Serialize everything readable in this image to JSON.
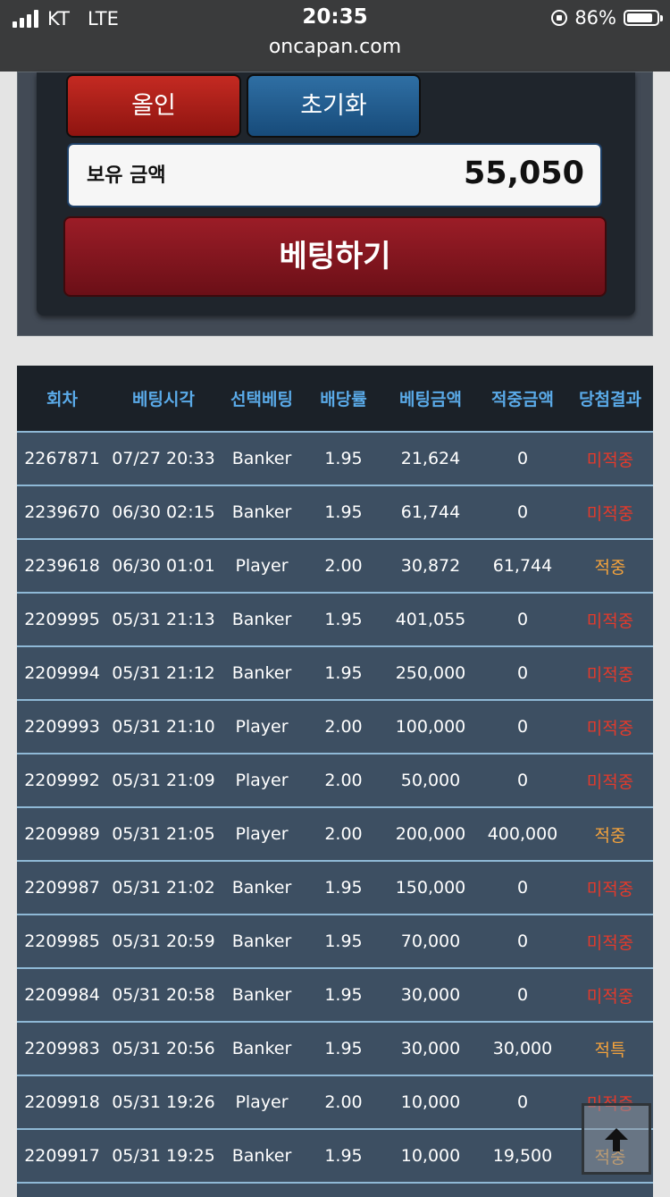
{
  "status_bar": {
    "carrier": "KT",
    "network": "LTE",
    "time": "20:35",
    "battery": "86%",
    "battery_level": 0.86,
    "url": "oncapan.com"
  },
  "controls": {
    "allin_label": "올인",
    "reset_label": "초기화",
    "balance_label": "보유 금액",
    "balance_value": "55,050",
    "bet_label": "베팅하기"
  },
  "table": {
    "headers": [
      "회차",
      "베팅시각",
      "선택베팅",
      "배당률",
      "베팅금액",
      "적중금액",
      "당첨결과"
    ],
    "rows": [
      {
        "round": "2267871",
        "time": "07/27 20:33",
        "choice": "Banker",
        "odds": "1.95",
        "bet": "21,624",
        "win": "0",
        "result": "미적중",
        "status": "miss"
      },
      {
        "round": "2239670",
        "time": "06/30 02:15",
        "choice": "Banker",
        "odds": "1.95",
        "bet": "61,744",
        "win": "0",
        "result": "미적중",
        "status": "miss"
      },
      {
        "round": "2239618",
        "time": "06/30 01:01",
        "choice": "Player",
        "odds": "2.00",
        "bet": "30,872",
        "win": "61,744",
        "result": "적중",
        "status": "hit"
      },
      {
        "round": "2209995",
        "time": "05/31 21:13",
        "choice": "Banker",
        "odds": "1.95",
        "bet": "401,055",
        "win": "0",
        "result": "미적중",
        "status": "miss"
      },
      {
        "round": "2209994",
        "time": "05/31 21:12",
        "choice": "Banker",
        "odds": "1.95",
        "bet": "250,000",
        "win": "0",
        "result": "미적중",
        "status": "miss"
      },
      {
        "round": "2209993",
        "time": "05/31 21:10",
        "choice": "Player",
        "odds": "2.00",
        "bet": "100,000",
        "win": "0",
        "result": "미적중",
        "status": "miss"
      },
      {
        "round": "2209992",
        "time": "05/31 21:09",
        "choice": "Player",
        "odds": "2.00",
        "bet": "50,000",
        "win": "0",
        "result": "미적중",
        "status": "miss"
      },
      {
        "round": "2209989",
        "time": "05/31 21:05",
        "choice": "Player",
        "odds": "2.00",
        "bet": "200,000",
        "win": "400,000",
        "result": "적중",
        "status": "hit"
      },
      {
        "round": "2209987",
        "time": "05/31 21:02",
        "choice": "Banker",
        "odds": "1.95",
        "bet": "150,000",
        "win": "0",
        "result": "미적중",
        "status": "miss"
      },
      {
        "round": "2209985",
        "time": "05/31 20:59",
        "choice": "Banker",
        "odds": "1.95",
        "bet": "70,000",
        "win": "0",
        "result": "미적중",
        "status": "miss"
      },
      {
        "round": "2209984",
        "time": "05/31 20:58",
        "choice": "Banker",
        "odds": "1.95",
        "bet": "30,000",
        "win": "0",
        "result": "미적중",
        "status": "miss"
      },
      {
        "round": "2209983",
        "time": "05/31 20:56",
        "choice": "Banker",
        "odds": "1.95",
        "bet": "30,000",
        "win": "30,000",
        "result": "적특",
        "status": "hit"
      },
      {
        "round": "2209918",
        "time": "05/31 19:26",
        "choice": "Player",
        "odds": "2.00",
        "bet": "10,000",
        "win": "0",
        "result": "미적중",
        "status": "miss"
      },
      {
        "round": "2209917",
        "time": "05/31 19:25",
        "choice": "Banker",
        "odds": "1.95",
        "bet": "10,000",
        "win": "19,500",
        "result": "적중",
        "status": "hit"
      }
    ]
  },
  "scroll_top": {
    "icon": "arrow-up-icon"
  },
  "colors": {
    "miss": "#e43a2b",
    "hit": "#f3a23c",
    "header_text": "#5aaae8"
  }
}
